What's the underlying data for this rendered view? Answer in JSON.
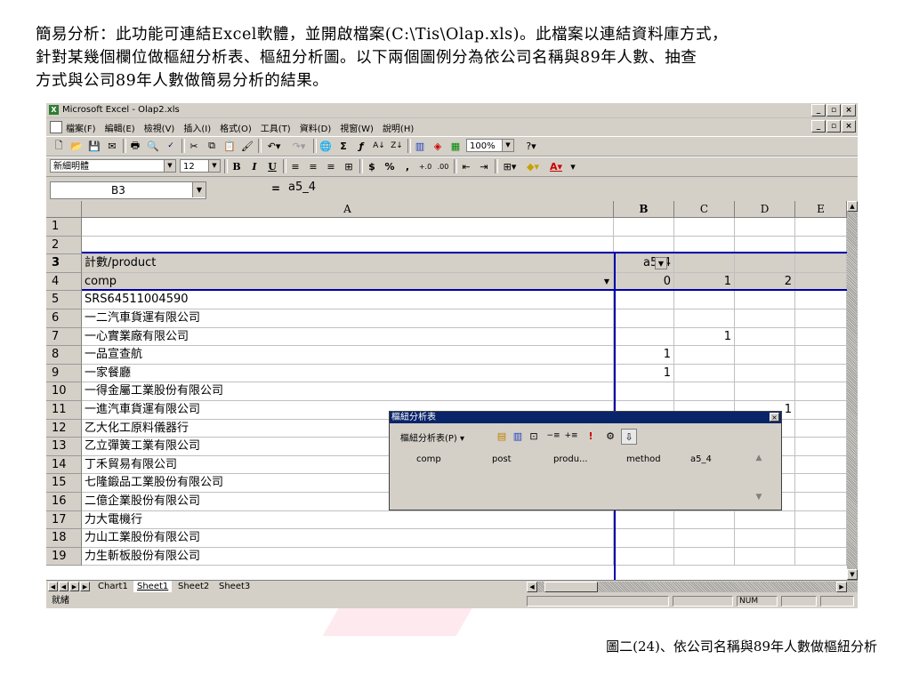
{
  "intro": {
    "line1": "簡易分析：此功能可連結Excel軟體，並開啟檔案(C:\\Tis\\Olap.xls)。此檔案以連結資料庫方式，",
    "line2": "針對某幾個欄位做樞紐分析表、樞紐分析圖。以下兩個圖例分為依公司名稱與89年人數、抽查",
    "line3": "方式與公司89年人數做簡易分析的結果。"
  },
  "caption": "圖二(24)、依公司名稱與89年人數做樞紐分析",
  "window": {
    "title": "Microsoft Excel - Olap2.xls",
    "menus": [
      "檔案(F)",
      "編輯(E)",
      "檢視(V)",
      "插入(I)",
      "格式(O)",
      "工具(T)",
      "資料(D)",
      "視窗(W)",
      "說明(H)"
    ],
    "zoom": "100%",
    "font_name": "新細明體",
    "font_size": "12",
    "name_box": "B3",
    "formula": "a5_4"
  },
  "columns": [
    "A",
    "B",
    "C",
    "D",
    "E"
  ],
  "rows": [
    {
      "n": "1",
      "a": "",
      "b": "",
      "c": "",
      "d": ""
    },
    {
      "n": "2",
      "a": "",
      "b": "",
      "c": "",
      "d": ""
    },
    {
      "n": "3",
      "a": "計數/product",
      "b": "a5_4",
      "c": "",
      "d": ""
    },
    {
      "n": "4",
      "a": "comp",
      "b": "0",
      "c": "1",
      "d": "2"
    },
    {
      "n": "5",
      "a": "SRS64511004590",
      "b": "",
      "c": "",
      "d": ""
    },
    {
      "n": "6",
      "a": "一二汽車貨運有限公司",
      "b": "",
      "c": "",
      "d": ""
    },
    {
      "n": "7",
      "a": "一心實業廠有限公司",
      "b": "",
      "c": "1",
      "d": ""
    },
    {
      "n": "8",
      "a": "一品宣查航",
      "b": "1",
      "c": "",
      "d": ""
    },
    {
      "n": "9",
      "a": "一家餐廳",
      "b": "1",
      "c": "",
      "d": ""
    },
    {
      "n": "10",
      "a": "一得金屬工業股份有限公司",
      "b": "",
      "c": "",
      "d": ""
    },
    {
      "n": "11",
      "a": "一進汽車貨運有限公司",
      "b": "",
      "c": "",
      "d": "1"
    },
    {
      "n": "12",
      "a": "乙大化工原料儀器行",
      "b": "",
      "c": "",
      "d": ""
    },
    {
      "n": "13",
      "a": "乙立彈簧工業有限公司",
      "b": "",
      "c": "",
      "d": ""
    },
    {
      "n": "14",
      "a": "丁禾貿易有限公司",
      "b": "",
      "c": "",
      "d": ""
    },
    {
      "n": "15",
      "a": "七隆鍛品工業股份有限公司",
      "b": "",
      "c": "",
      "d": ""
    },
    {
      "n": "16",
      "a": "二億企業股份有限公司",
      "b": "",
      "c": "",
      "d": ""
    },
    {
      "n": "17",
      "a": "力大電機行",
      "b": "",
      "c": "",
      "d": ""
    },
    {
      "n": "18",
      "a": "力山工業股份有限公司",
      "b": "",
      "c": "",
      "d": ""
    },
    {
      "n": "19",
      "a": "力生斬板股份有限公司",
      "b": "",
      "c": "",
      "d": ""
    }
  ],
  "sheet_tabs": [
    "Chart1",
    "Sheet1",
    "Sheet2",
    "Sheet3"
  ],
  "status": {
    "ready": "就緒",
    "num": "NUM"
  },
  "pivot_toolbar": {
    "title": "樞紐分析表",
    "menu": "樞紐分析表(P) ▾",
    "fields": [
      "comp",
      "post",
      "produ...",
      "method",
      "a5_4"
    ]
  }
}
